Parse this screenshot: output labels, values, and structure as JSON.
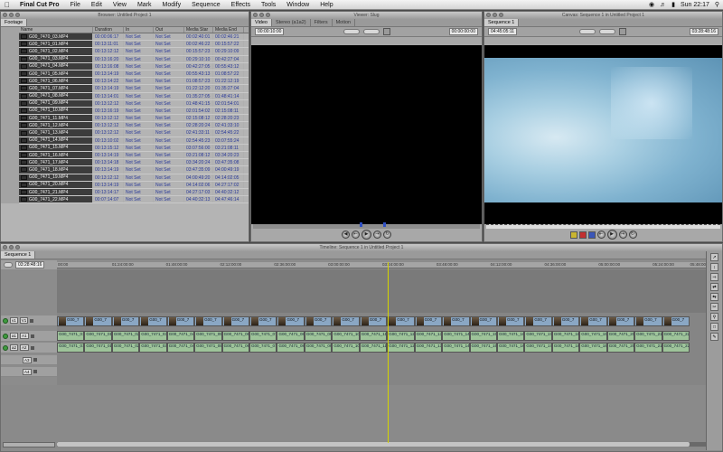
{
  "menubar": {
    "app": "Final Cut Pro",
    "items": [
      "File",
      "Edit",
      "View",
      "Mark",
      "Modify",
      "Sequence",
      "Effects",
      "Tools",
      "Window",
      "Help"
    ],
    "clock": "Sun 22:17"
  },
  "browser": {
    "title": "Browser: Untitled Project 1",
    "tab": "Footage",
    "columns": [
      "Name",
      "Duration",
      "In",
      "Out",
      "Media Star",
      "Media End"
    ],
    "rows": [
      [
        "G00_7470_03.MP4",
        "00:00:06:17",
        "Not Set",
        "Not Set",
        "00:02:40:01",
        "00:02:46:21"
      ],
      [
        "G00_7471_01.MP4",
        "00:13:11:01",
        "Not Set",
        "Not Set",
        "00:02:46:22",
        "00:15:57:22"
      ],
      [
        "G00_7471_02.MP4",
        "00:13:12:12",
        "Not Set",
        "Not Set",
        "00:15:57:23",
        "00:29:10:09"
      ],
      [
        "G00_7471_03.MP4",
        "00:13:16:20",
        "Not Set",
        "Not Set",
        "00:29:10:10",
        "00:42:27:04"
      ],
      [
        "G00_7471_04.MP4",
        "00:13:16:08",
        "Not Set",
        "Not Set",
        "00:42:27:05",
        "00:55:43:12"
      ],
      [
        "G00_7471_05.MP4",
        "00:13:14:19",
        "Not Set",
        "Not Set",
        "00:55:43:13",
        "01:08:57:22"
      ],
      [
        "G00_7471_06.MP4",
        "00:13:14:22",
        "Not Set",
        "Not Set",
        "01:08:57:23",
        "01:22:12:19"
      ],
      [
        "G00_7471_07.MP4",
        "00:13:14:19",
        "Not Set",
        "Not Set",
        "01:22:12:20",
        "01:35:27:04"
      ],
      [
        "G00_7471_08.MP4",
        "00:13:14:01",
        "Not Set",
        "Not Set",
        "01:35:27:05",
        "01:48:41:14"
      ],
      [
        "G00_7471_09.MP4",
        "00:13:12:12",
        "Not Set",
        "Not Set",
        "01:48:41:15",
        "02:01:54:01"
      ],
      [
        "G00_7471_10.MP4",
        "00:13:16:19",
        "Not Set",
        "Not Set",
        "02:01:54:02",
        "02:15:08:11"
      ],
      [
        "G00_7471_11.MP4",
        "00:13:12:12",
        "Not Set",
        "Not Set",
        "02:15:08:12",
        "02:28:20:23"
      ],
      [
        "G00_7471_12.MP4",
        "00:13:12:12",
        "Not Set",
        "Not Set",
        "02:28:20:24",
        "02:41:33:10"
      ],
      [
        "G00_7471_13.MP4",
        "00:13:12:12",
        "Not Set",
        "Not Set",
        "02:41:33:11",
        "02:54:45:22"
      ],
      [
        "G00_7471_14.MP4",
        "00:13:10:02",
        "Not Set",
        "Not Set",
        "02:54:45:23",
        "03:07:55:24"
      ],
      [
        "G00_7471_15.MP4",
        "00:13:15:12",
        "Not Set",
        "Not Set",
        "03:07:56:00",
        "03:21:08:11"
      ],
      [
        "G00_7471_16.MP4",
        "00:13:14:19",
        "Not Set",
        "Not Set",
        "03:21:08:12",
        "03:34:20:23"
      ],
      [
        "G00_7471_17.MP4",
        "00:13:14:18",
        "Not Set",
        "Not Set",
        "03:34:20:24",
        "03:47:35:08"
      ],
      [
        "G00_7471_18.MP4",
        "00:13:14:19",
        "Not Set",
        "Not Set",
        "03:47:35:09",
        "04:00:49:19"
      ],
      [
        "G00_7471_19.MP4",
        "00:13:12:12",
        "Not Set",
        "Not Set",
        "04:00:49:20",
        "04:14:02:05"
      ],
      [
        "G00_7471_20.MP4",
        "00:13:14:19",
        "Not Set",
        "Not Set",
        "04:14:02:06",
        "04:27:17:02"
      ],
      [
        "G00_7471_21.MP4",
        "00:13:14:17",
        "Not Set",
        "Not Set",
        "04:27:17:03",
        "04:40:32:12"
      ],
      [
        "G00_7471_22.MP4",
        "00:07:14:07",
        "Not Set",
        "Not Set",
        "04:40:32:13",
        "04:47:46:14"
      ]
    ]
  },
  "viewer": {
    "title": "Viewer: Slug",
    "tabs": [
      "Video",
      "Stereo (a1a2)",
      "Filters",
      "Motion"
    ],
    "timecode_left": "00:00:10:00",
    "timecode_right": "00:00:00:00"
  },
  "canvas": {
    "title": "Canvas: Sequence 1 in Untitled Project 1",
    "tab": "Sequence 1",
    "timecode_left": "04:45:05:11",
    "timecode_right": "03:28:48:16"
  },
  "timeline": {
    "title": "Timeline: Sequence 1 in Untitled Project 1",
    "tab": "Sequence 1",
    "current_tc": "03:28:48:16",
    "ruler": [
      "00:00",
      "01:24:00:00",
      "01:48:00:00",
      "02:12:00:00",
      "02:36:00:00",
      "03:00:00:00",
      "03:24:00:00",
      "03:48:00:00",
      "04:12:00:00",
      "04:36:00:00",
      "05:00:00:00",
      "05:24:00:00",
      "05:48:00"
    ],
    "tracks": [
      {
        "src": "v1",
        "dst": "V1"
      },
      {
        "src": "a1",
        "dst": "A1"
      },
      {
        "src": "a2",
        "dst": "A2"
      },
      {
        "src": "",
        "dst": "A3"
      },
      {
        "src": "",
        "dst": "A4"
      }
    ],
    "video_clips": [
      "G00_7",
      "G00_7",
      "G00_7",
      "G00_7",
      "G00_7",
      "G00_7",
      "G00_7",
      "G00_7",
      "G00_7",
      "G00_7",
      "G00_7",
      "G00_7",
      "G00_7",
      "G00_7",
      "G00_7",
      "G00_7",
      "G00_7",
      "G00_7",
      "G00_7",
      "G00_7",
      "G00_7",
      "G00_7",
      "G00_7"
    ],
    "audio_clips": [
      "G00_7471_01",
      "G00_7471_01",
      "G00_7471_02",
      "G00_7471_03",
      "G00_7471_04",
      "G00_7471_05",
      "G00_7471_06",
      "G00_7471_07",
      "G00_7471_08",
      "G00_7471_09",
      "G00_7471_10",
      "G00_7471_11",
      "G00_7471_12",
      "G00_7471_13",
      "G00_7471_14",
      "G00_7471_15",
      "G00_7471_16",
      "G00_7471_17",
      "G00_7471_18",
      "G00_7471_19",
      "G00_7471_20",
      "G00_7471_21",
      "G00_7471_22"
    ]
  },
  "colors": {
    "video_clip": "#8aa7c4",
    "audio_clip": "#9ec49a",
    "playhead": "#d4d400",
    "track_dot": "#3f9a3f"
  }
}
